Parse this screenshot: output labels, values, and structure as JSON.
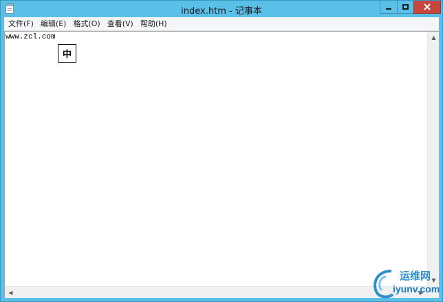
{
  "window": {
    "title": "index.htm - 记事本"
  },
  "menu": {
    "items": [
      {
        "label": "文件(F)"
      },
      {
        "label": "编辑(E)"
      },
      {
        "label": "格式(O)"
      },
      {
        "label": "查看(V)"
      },
      {
        "label": "帮助(H)"
      }
    ]
  },
  "editor": {
    "content": "www.zcl.com",
    "ime_indicator": "中"
  },
  "watermark": {
    "line1": "运维网",
    "line2": "iyunv.com"
  },
  "colors": {
    "titlebar": "#5bc0e8",
    "close": "#c7463b",
    "watermark": "#2f8fc8"
  },
  "icons": [
    "notepad-icon",
    "minimize-icon",
    "maximize-icon",
    "close-icon",
    "scroll-up-icon",
    "scroll-down-icon",
    "scroll-left-icon",
    "scroll-right-icon"
  ]
}
